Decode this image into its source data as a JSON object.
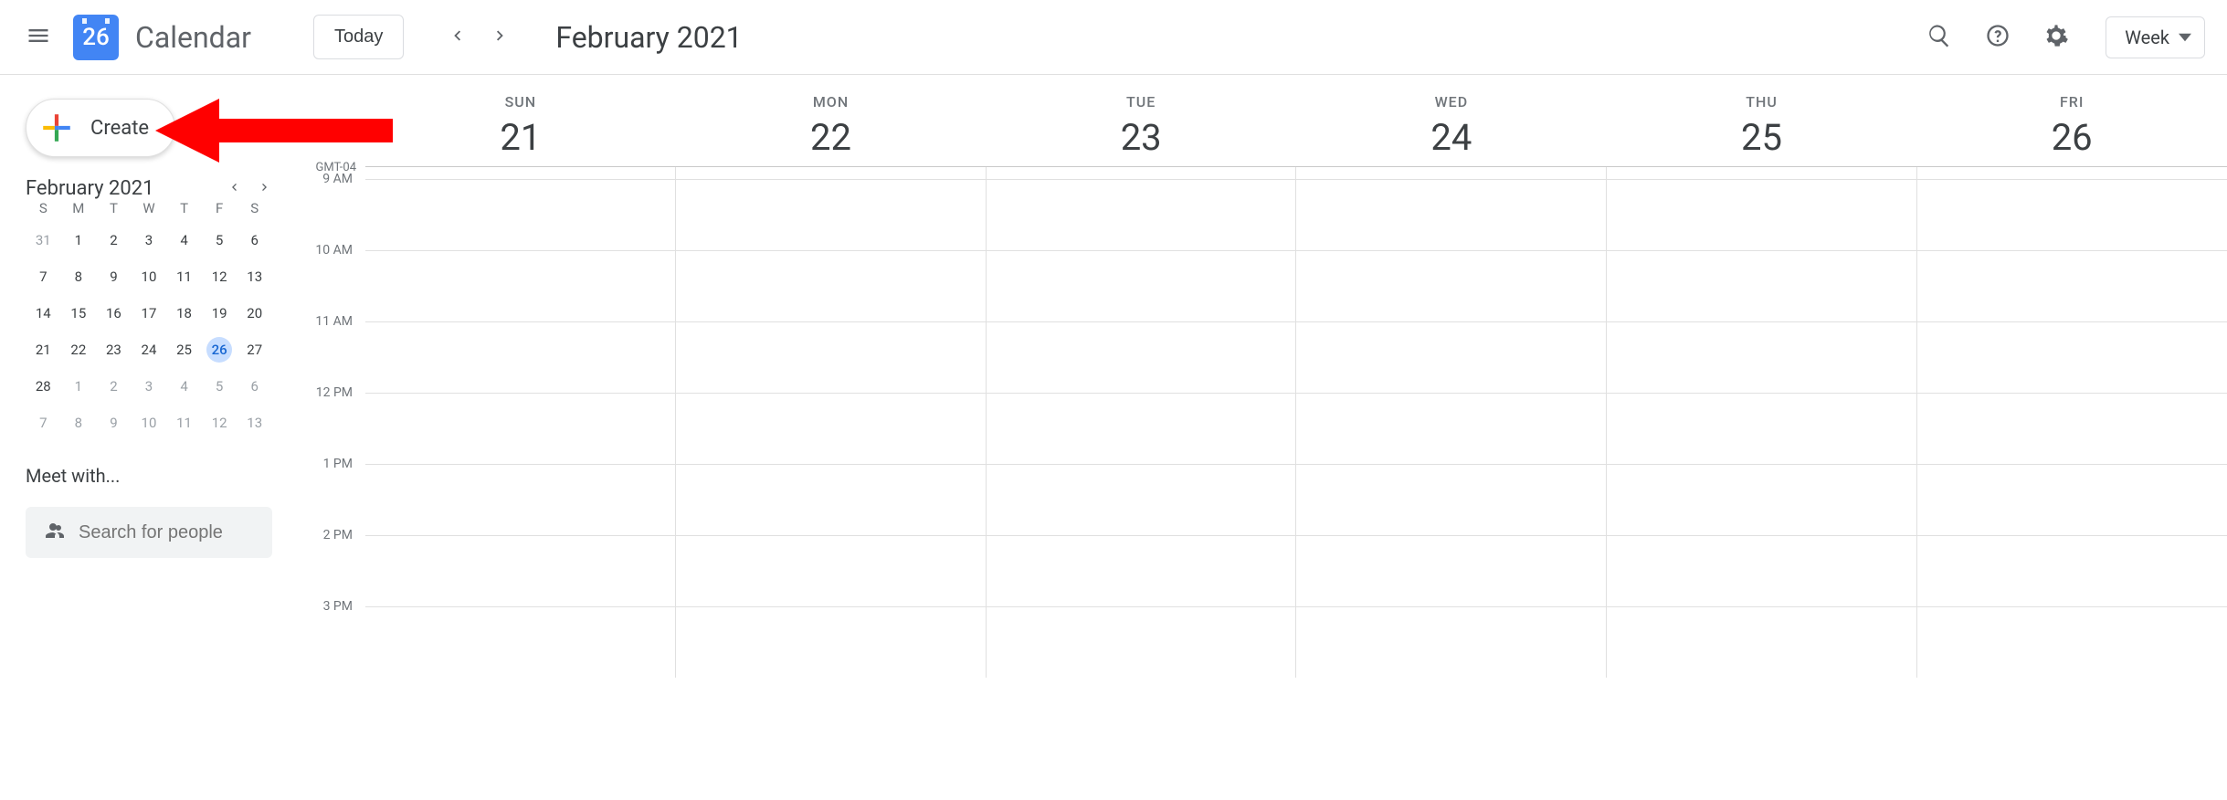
{
  "header": {
    "logo_day": "26",
    "app_title": "Calendar",
    "today_label": "Today",
    "current_range": "February 2021",
    "view_label": "Week"
  },
  "sidebar": {
    "create_label": "Create",
    "minical_title": "February 2021",
    "dow": [
      "S",
      "M",
      "T",
      "W",
      "T",
      "F",
      "S"
    ],
    "weeks": [
      [
        {
          "d": "31",
          "other": true
        },
        {
          "d": "1"
        },
        {
          "d": "2"
        },
        {
          "d": "3"
        },
        {
          "d": "4"
        },
        {
          "d": "5"
        },
        {
          "d": "6"
        }
      ],
      [
        {
          "d": "7"
        },
        {
          "d": "8"
        },
        {
          "d": "9"
        },
        {
          "d": "10"
        },
        {
          "d": "11"
        },
        {
          "d": "12"
        },
        {
          "d": "13"
        }
      ],
      [
        {
          "d": "14"
        },
        {
          "d": "15"
        },
        {
          "d": "16"
        },
        {
          "d": "17"
        },
        {
          "d": "18"
        },
        {
          "d": "19"
        },
        {
          "d": "20"
        }
      ],
      [
        {
          "d": "21"
        },
        {
          "d": "22"
        },
        {
          "d": "23"
        },
        {
          "d": "24"
        },
        {
          "d": "25"
        },
        {
          "d": "26",
          "today": true
        },
        {
          "d": "27"
        }
      ],
      [
        {
          "d": "28"
        },
        {
          "d": "1",
          "other": true
        },
        {
          "d": "2",
          "other": true
        },
        {
          "d": "3",
          "other": true
        },
        {
          "d": "4",
          "other": true
        },
        {
          "d": "5",
          "other": true
        },
        {
          "d": "6",
          "other": true
        }
      ],
      [
        {
          "d": "7",
          "other": true
        },
        {
          "d": "8",
          "other": true
        },
        {
          "d": "9",
          "other": true
        },
        {
          "d": "10",
          "other": true
        },
        {
          "d": "11",
          "other": true
        },
        {
          "d": "12",
          "other": true
        },
        {
          "d": "13",
          "other": true
        }
      ]
    ],
    "meet_with_label": "Meet with...",
    "search_people_placeholder": "Search for people"
  },
  "grid": {
    "days": [
      {
        "dow": "SUN",
        "num": "21"
      },
      {
        "dow": "MON",
        "num": "22"
      },
      {
        "dow": "TUE",
        "num": "23"
      },
      {
        "dow": "WED",
        "num": "24"
      },
      {
        "dow": "THU",
        "num": "25"
      },
      {
        "dow": "FRI",
        "num": "26"
      }
    ],
    "tz": "GMT-04",
    "hours": [
      "9 AM",
      "10 AM",
      "11 AM",
      "12 PM",
      "1 PM",
      "2 PM",
      "3 PM"
    ]
  }
}
